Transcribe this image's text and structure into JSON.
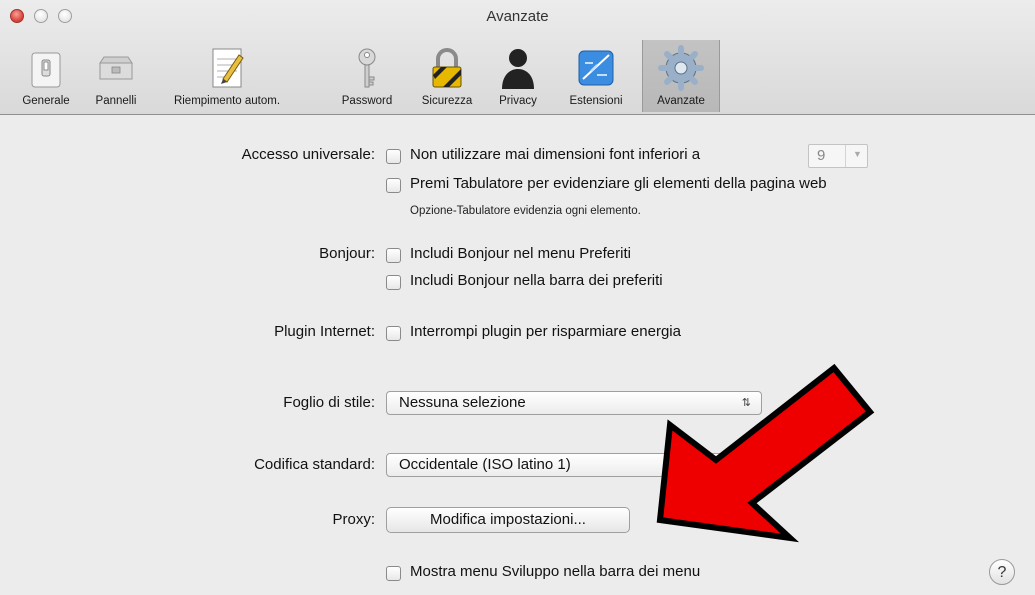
{
  "window": {
    "title": "Avanzate"
  },
  "toolbar": {
    "items": [
      {
        "label": "Generale",
        "icon": "switch-icon"
      },
      {
        "label": "Pannelli",
        "icon": "tabs-icon"
      },
      {
        "label": "Riempimento autom.",
        "icon": "pencil-form-icon"
      },
      {
        "label": "Password",
        "icon": "key-icon"
      },
      {
        "label": "Sicurezza",
        "icon": "padlock-icon"
      },
      {
        "label": "Privacy",
        "icon": "person-silhouette-icon"
      },
      {
        "label": "Estensioni",
        "icon": "puzzle-icon"
      },
      {
        "label": "Avanzate",
        "icon": "gear-icon",
        "selected": true
      }
    ]
  },
  "settings": {
    "universal_access": {
      "label": "Accesso universale:",
      "min_font": {
        "label": "Non utilizzare mai dimensioni font inferiori a",
        "checked": false,
        "value": "9"
      },
      "tab_highlight": {
        "label": "Premi Tabulatore per evidenziare gli elementi della pagina web",
        "checked": false
      },
      "hint": "Opzione-Tabulatore evidenzia ogni elemento."
    },
    "bonjour": {
      "label": "Bonjour:",
      "in_bookmarks_menu": {
        "label": "Includi Bonjour nel menu Preferiti",
        "checked": false
      },
      "in_bookmarks_bar": {
        "label": "Includi Bonjour nella barra dei preferiti",
        "checked": false
      }
    },
    "internet_plugins": {
      "label": "Plugin Internet:",
      "stop_plugins": {
        "label": "Interrompi plugin per risparmiare energia",
        "checked": false
      }
    },
    "style_sheet": {
      "label": "Foglio di stile:",
      "value": "Nessuna selezione"
    },
    "default_encoding": {
      "label": "Codifica standard:",
      "value": "Occidentale (ISO latino 1)"
    },
    "proxy": {
      "label": "Proxy:",
      "button": "Modifica impostazioni..."
    },
    "develop_menu": {
      "label": "Mostra menu Sviluppo nella barra dei menu",
      "checked": false
    },
    "help": "?"
  },
  "annotation": {
    "arrow_color": "#ee0000",
    "outline_color": "#000000"
  },
  "colors": {
    "window_bg": "#ececec",
    "close_button": "#dd4a41"
  }
}
